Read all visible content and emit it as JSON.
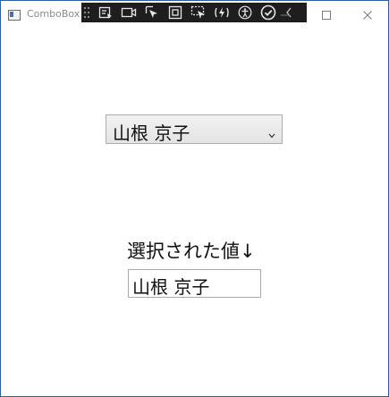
{
  "window": {
    "title": "ComboBox"
  },
  "debug_toolbar": {
    "buttons": [
      "live-visual-tree-icon",
      "camera-icon",
      "select-element-icon",
      "display-layout-adorners-icon",
      "track-focus-icon",
      "hot-reload-icon",
      "accessibility-icon",
      "check-icon",
      "collapse-chevron-icon"
    ]
  },
  "combobox": {
    "selected": "山根 京子"
  },
  "selected_label": "選択された値↓",
  "selected_value": "山根 京子",
  "colors": {
    "window_border": "#2a5f9e",
    "toolbar_bg": "#1e1e1e",
    "combo_border": "#acacac",
    "text": "#111111"
  }
}
